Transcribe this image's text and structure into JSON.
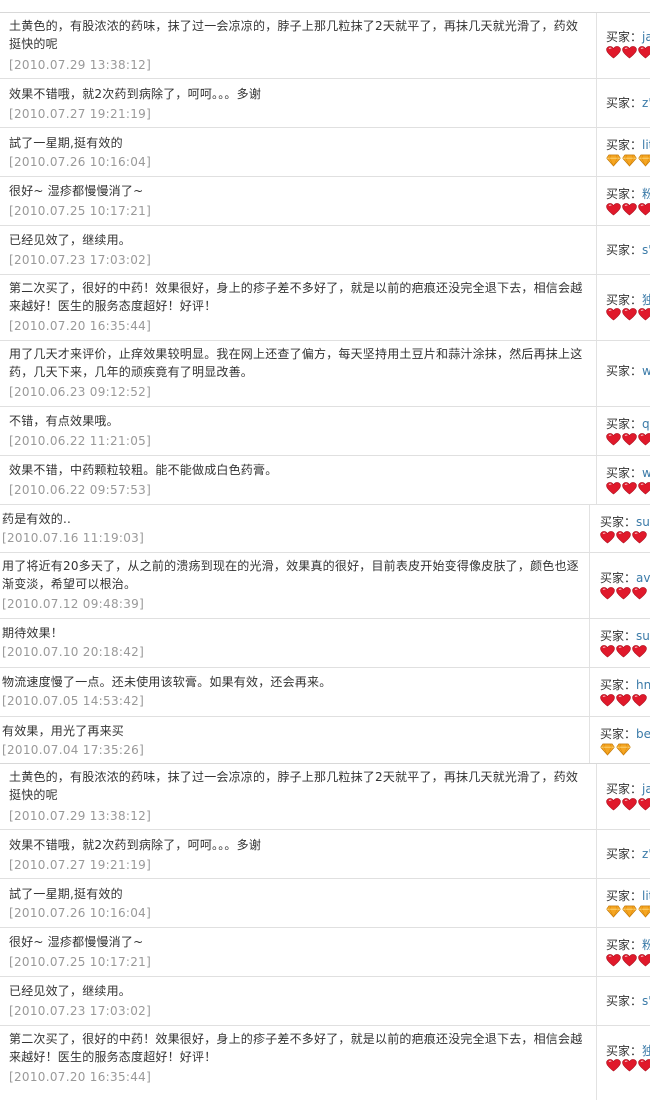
{
  "icons": {
    "heart": "red-heart-icon",
    "diamond": "gold-diamond-icon"
  },
  "colors": {
    "date": "#999999",
    "buyer_name": "#3a7aa8",
    "heart": "#e0192b",
    "diamond": "#f5a623"
  },
  "block1": [
    {
      "comment": "土黄色的，有股浓浓的药味，抹了过一会凉凉的，脖子上那几粒抹了2天就平了，再抹几天就光滑了，药效挺快的呢",
      "date": "[2010.07.29 13:38:12]",
      "buyer_label": "买家：",
      "buyer_name": "ja",
      "badge_type": "heart",
      "badge_count": 3
    },
    {
      "comment": "效果不错哦，就2次药到病除了，呵呵。。。多谢",
      "date": "[2010.07.27 19:21:19]",
      "buyer_label": "买家：",
      "buyer_name": "z'",
      "badge_type": "none",
      "badge_count": 0
    },
    {
      "comment": "試了一星期,挺有效的",
      "date": "[2010.07.26 10:16:04]",
      "buyer_label": "买家：",
      "buyer_name": "lit",
      "badge_type": "diamond",
      "badge_count": 3
    },
    {
      "comment": "很好~ 湿疹都慢慢消了~",
      "date": "[2010.07.25 10:17:21]",
      "buyer_label": "买家：",
      "buyer_name": "粉",
      "badge_type": "heart",
      "badge_count": 3
    },
    {
      "comment": "已经见效了，继续用。",
      "date": "[2010.07.23 17:03:02]",
      "buyer_label": "买家：",
      "buyer_name": "s'",
      "badge_type": "none",
      "badge_count": 0
    },
    {
      "comment": "第二次买了，很好的中药！效果很好，身上的疹子差不多好了，就是以前的疤痕还没完全退下去，相信会越来越好！医生的服务态度超好！好评！",
      "date": "[2010.07.20 16:35:44]",
      "buyer_label": "买家：",
      "buyer_name": "独",
      "badge_type": "heart",
      "badge_count": 3
    },
    {
      "comment": "用了几天才来评价，止痒效果较明显。我在网上还查了偏方，每天坚持用土豆片和蒜汁涂抹，然后再抹上这药，几天下来，几年的顽疾竟有了明显改善。",
      "date": "[2010.06.23 09:12:52]",
      "buyer_label": "买家：",
      "buyer_name": "w",
      "badge_type": "none",
      "badge_count": 0
    },
    {
      "comment": "不错，有点效果哦。",
      "date": "[2010.06.22 11:21:05]",
      "buyer_label": "买家：",
      "buyer_name": "ql",
      "badge_type": "heart",
      "badge_count": 3
    },
    {
      "comment": "效果不错，中药颗粒较粗。能不能做成白色药膏。",
      "date": "[2010.06.22 09:57:53]",
      "buyer_label": "买家：",
      "buyer_name": "w",
      "badge_type": "heart",
      "badge_count": 3
    }
  ],
  "block2": [
    {
      "comment": "药是有效的..",
      "date": "[2010.07.16 11:19:03]",
      "buyer_label": "买家：",
      "buyer_name": "sur",
      "badge_type": "heart",
      "badge_count": 3
    },
    {
      "comment": "用了将近有20多天了，从之前的溃疡到现在的光滑，效果真的很好，目前表皮开始变得像皮肤了，颜色也逐渐变淡，希望可以根治。",
      "date": "[2010.07.12 09:48:39]",
      "buyer_label": "买家：",
      "buyer_name": "avi",
      "badge_type": "heart",
      "badge_count": 3
    },
    {
      "comment": "期待效果！",
      "date": "[2010.07.10 20:18:42]",
      "buyer_label": "买家：",
      "buyer_name": "sur",
      "badge_type": "heart",
      "badge_count": 3
    },
    {
      "comment": "物流速度慢了一点。还未使用该软膏。如果有效，还会再来。",
      "date": "[2010.07.05 14:53:42]",
      "buyer_label": "买家：",
      "buyer_name": "hn",
      "badge_type": "heart",
      "badge_count": 3
    },
    {
      "comment": "有效果，用光了再来买",
      "date": "[2010.07.04 17:35:26]",
      "buyer_label": "买家：",
      "buyer_name": "be",
      "badge_type": "diamond",
      "badge_count": 2
    }
  ],
  "block3": [
    {
      "comment": "土黄色的，有股浓浓的药味，抹了过一会凉凉的，脖子上那几粒抹了2天就平了，再抹几天就光滑了，药效挺快的呢",
      "date": "[2010.07.29 13:38:12]",
      "buyer_label": "买家：",
      "buyer_name": "ja",
      "badge_type": "heart",
      "badge_count": 3
    },
    {
      "comment": "效果不错哦，就2次药到病除了，呵呵。。。多谢",
      "date": "[2010.07.27 19:21:19]",
      "buyer_label": "买家：",
      "buyer_name": "z'",
      "badge_type": "none",
      "badge_count": 0
    },
    {
      "comment": "試了一星期,挺有效的",
      "date": "[2010.07.26 10:16:04]",
      "buyer_label": "买家：",
      "buyer_name": "lit",
      "badge_type": "diamond",
      "badge_count": 3
    },
    {
      "comment": "很好~ 湿疹都慢慢消了~",
      "date": "[2010.07.25 10:17:21]",
      "buyer_label": "买家：",
      "buyer_name": "粉",
      "badge_type": "heart",
      "badge_count": 3
    },
    {
      "comment": "已经见效了，继续用。",
      "date": "[2010.07.23 17:03:02]",
      "buyer_label": "买家：",
      "buyer_name": "s'",
      "badge_type": "none",
      "badge_count": 0
    },
    {
      "comment": "第二次买了，很好的中药！效果很好，身上的疹子差不多好了，就是以前的疤痕还没完全退下去，相信会越来越好！医生的服务态度超好！好评！",
      "date": "[2010.07.20 16:35:44]",
      "buyer_label": "买家：",
      "buyer_name": "独",
      "badge_type": "heart",
      "badge_count": 3
    }
  ]
}
